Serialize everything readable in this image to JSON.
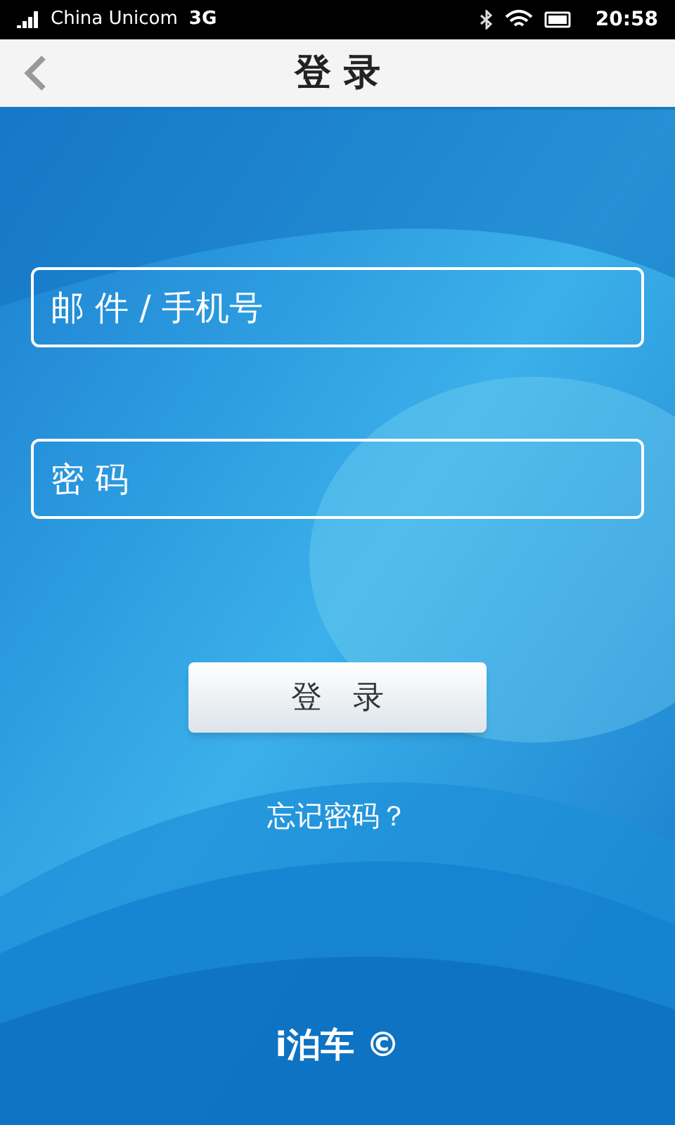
{
  "status_bar": {
    "carrier": "China Unicom",
    "network": "3G",
    "time": "20:58"
  },
  "header": {
    "title": "登 录"
  },
  "form": {
    "fields": [
      {
        "placeholder": "邮 件 / 手机号"
      },
      {
        "placeholder": "密 码"
      }
    ],
    "login_button": "登　录",
    "forgot_link": "忘记密码？"
  },
  "footer": {
    "brand": "i泊车 ©"
  }
}
